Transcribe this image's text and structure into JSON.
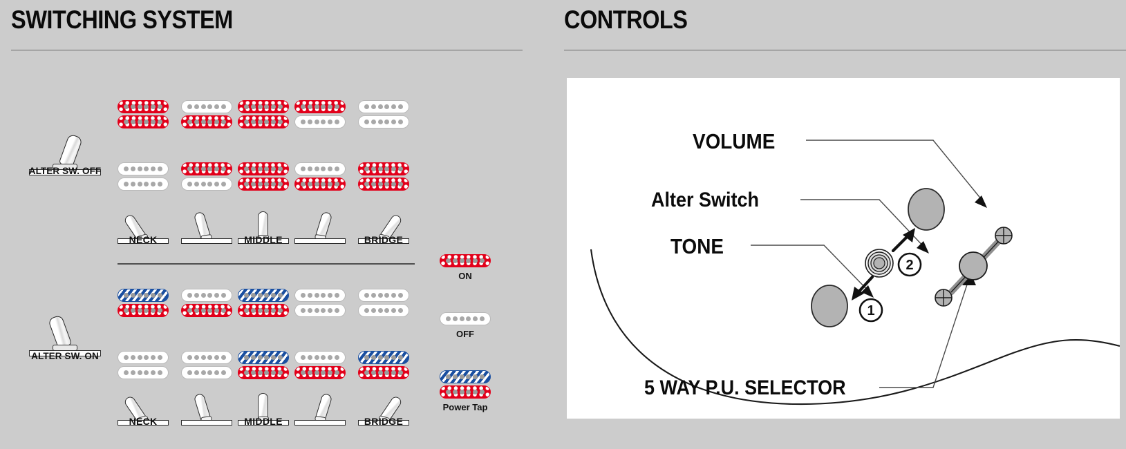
{
  "meta": {
    "background_color": "#cccccc",
    "accent_on_color": "#e2001a",
    "accent_tap_color": "#1a4fa0",
    "knob_color": "#b3b3b3"
  },
  "panels": {
    "switching": {
      "title": "SWITCHING SYSTEM"
    },
    "controls": {
      "title": "CONTROLS"
    }
  },
  "switching": {
    "groups": [
      {
        "id": "alter-off",
        "switch_label": "ALTER SW. OFF",
        "switch_state": "off",
        "position_labels": [
          "NECK",
          "",
          "MIDDLE",
          "",
          "BRIDGE"
        ],
        "positions": [
          {
            "index": 1,
            "neck_pickup": [
              "on",
              "on"
            ],
            "bridge_pickup": [
              "off",
              "off"
            ]
          },
          {
            "index": 2,
            "neck_pickup": [
              "off",
              "on"
            ],
            "bridge_pickup": [
              "on",
              "off"
            ]
          },
          {
            "index": 3,
            "neck_pickup": [
              "on",
              "on"
            ],
            "bridge_pickup": [
              "on",
              "on"
            ]
          },
          {
            "index": 4,
            "neck_pickup": [
              "on",
              "off"
            ],
            "bridge_pickup": [
              "off",
              "on"
            ]
          },
          {
            "index": 5,
            "neck_pickup": [
              "off",
              "off"
            ],
            "bridge_pickup": [
              "on",
              "on"
            ]
          }
        ]
      },
      {
        "id": "alter-on",
        "switch_label": "ALTER SW. ON",
        "switch_state": "on",
        "position_labels": [
          "NECK",
          "",
          "MIDDLE",
          "",
          "BRIDGE"
        ],
        "positions": [
          {
            "index": 1,
            "neck_pickup": [
              "tap",
              "on"
            ],
            "bridge_pickup": [
              "off",
              "off"
            ]
          },
          {
            "index": 2,
            "neck_pickup": [
              "off",
              "on"
            ],
            "bridge_pickup": [
              "off",
              "off"
            ]
          },
          {
            "index": 3,
            "neck_pickup": [
              "tap",
              "on"
            ],
            "bridge_pickup": [
              "tap",
              "on"
            ]
          },
          {
            "index": 4,
            "neck_pickup": [
              "off",
              "off"
            ],
            "bridge_pickup": [
              "off",
              "on"
            ]
          },
          {
            "index": 5,
            "neck_pickup": [
              "off",
              "off"
            ],
            "bridge_pickup": [
              "tap",
              "on"
            ]
          }
        ]
      }
    ],
    "legend": [
      {
        "id": "on",
        "label": "ON",
        "coils": [
          "on"
        ]
      },
      {
        "id": "off",
        "label": "OFF",
        "coils": [
          "off"
        ]
      },
      {
        "id": "power-tap",
        "label": "Power Tap",
        "coils": [
          "tap",
          "on"
        ]
      }
    ]
  },
  "controls": {
    "labels": {
      "volume": "VOLUME",
      "alter_switch": "Alter Switch",
      "tone": "TONE",
      "selector": "5 WAY P.U. SELECTOR"
    },
    "callouts": [
      {
        "id": "alter-position-1",
        "text": "1"
      },
      {
        "id": "alter-position-2",
        "text": "2"
      }
    ]
  }
}
